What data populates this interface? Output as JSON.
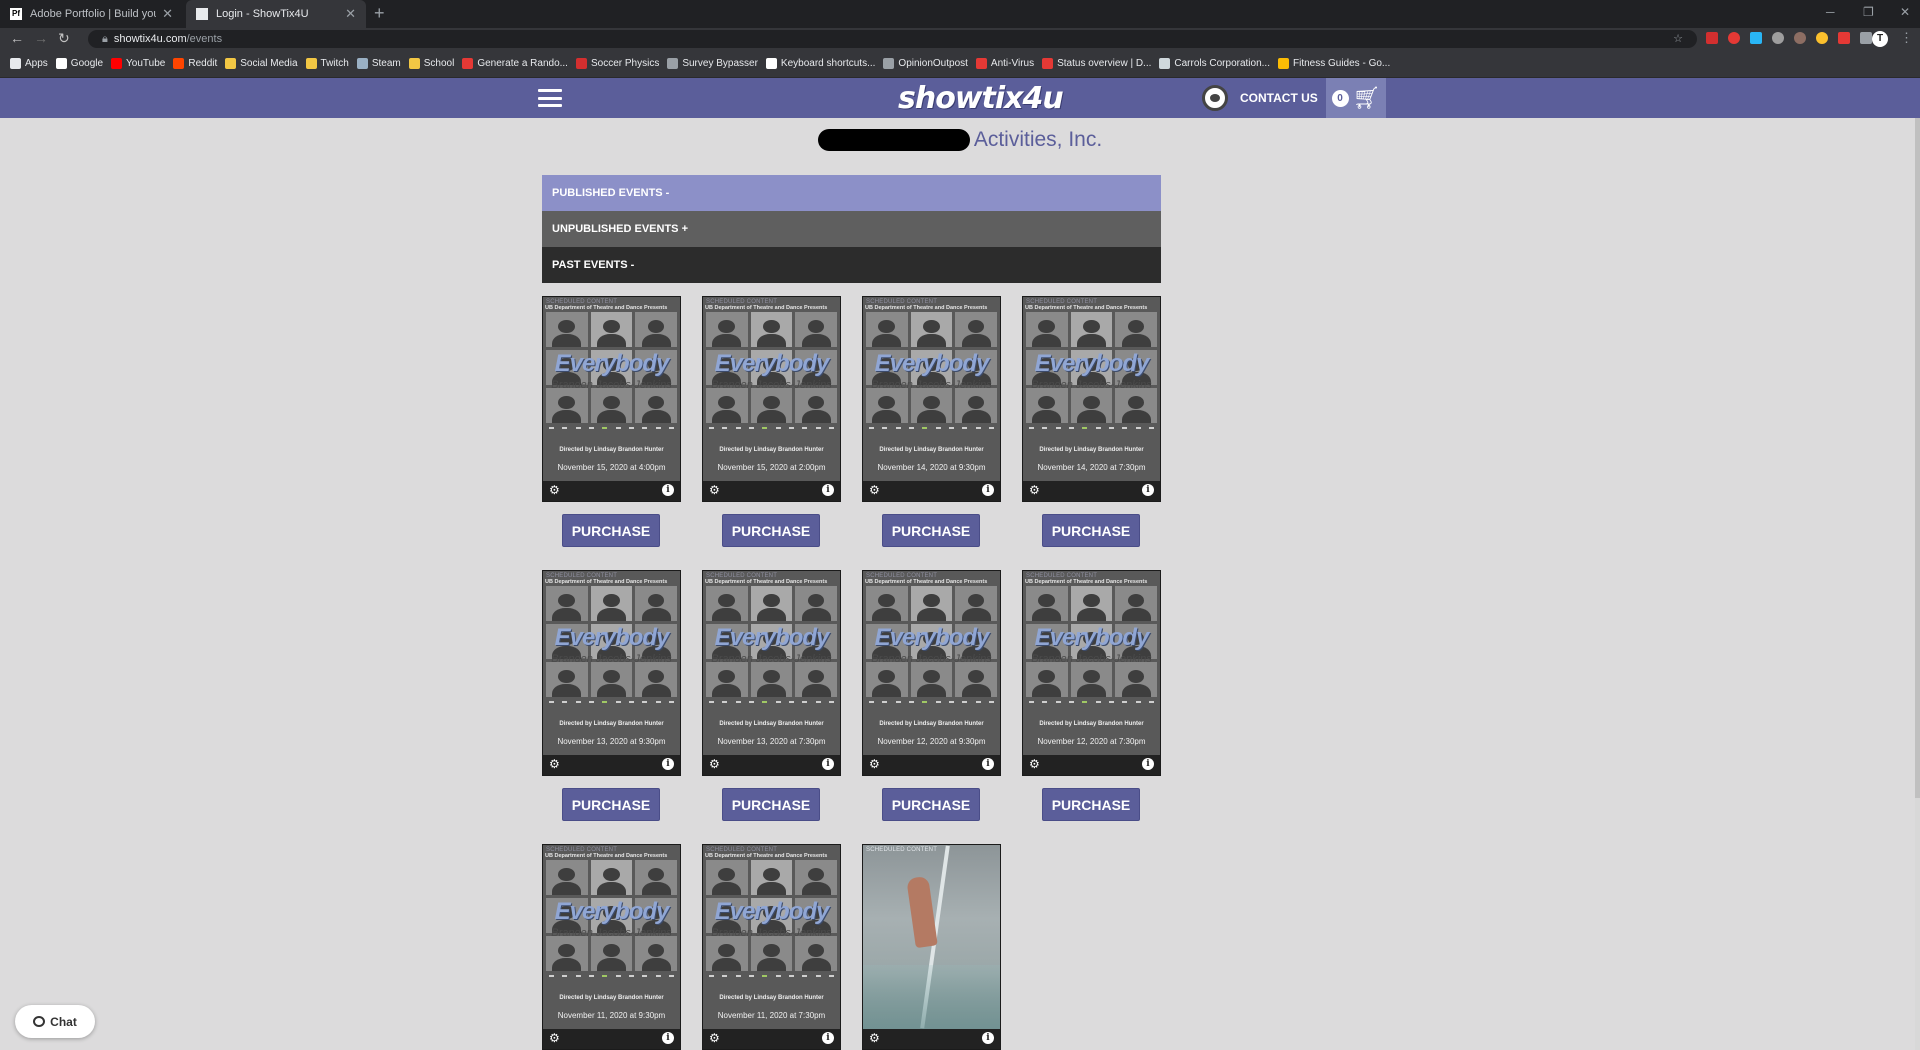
{
  "browser": {
    "tabs": [
      {
        "label": "Adobe Portfolio | Build your own",
        "favicon": "Pf"
      },
      {
        "label": "Login - ShowTix4U"
      }
    ],
    "url_host": "showtix4u.com",
    "url_path": "/events",
    "bookmarks": [
      {
        "label": "Apps",
        "icon": "grid-icon",
        "color": "#e8eaed"
      },
      {
        "label": "Google",
        "icon": "google-icon",
        "color": "#ffffff"
      },
      {
        "label": "YouTube",
        "icon": "youtube-icon",
        "color": "#ff0000"
      },
      {
        "label": "Reddit",
        "icon": "reddit-icon",
        "color": "#ff4500"
      },
      {
        "label": "Social Media",
        "icon": "folder-icon",
        "color": "#f2c744"
      },
      {
        "label": "Twitch",
        "icon": "folder-icon",
        "color": "#f2c744"
      },
      {
        "label": "Steam",
        "icon": "steam-icon",
        "color": "#9ab0c4"
      },
      {
        "label": "School",
        "icon": "folder-icon",
        "color": "#f2c744"
      },
      {
        "label": "Generate a Rando...",
        "icon": "f-icon",
        "color": "#e53935"
      },
      {
        "label": "Soccer Physics",
        "icon": "k-icon",
        "color": "#d32f2f"
      },
      {
        "label": "Survey Bypasser",
        "icon": "globe-icon",
        "color": "#9aa0a6"
      },
      {
        "label": "Keyboard shortcuts...",
        "icon": "google-icon",
        "color": "#ffffff"
      },
      {
        "label": "OpinionOutpost",
        "icon": "globe-icon",
        "color": "#9aa0a6"
      },
      {
        "label": "Anti-Virus",
        "icon": "shield-icon",
        "color": "#e53935"
      },
      {
        "label": "Status overview | D...",
        "icon": "alert-icon",
        "color": "#e53935"
      },
      {
        "label": "Carrols Corporation...",
        "icon": "doc-icon",
        "color": "#cfd8dc"
      },
      {
        "label": "Fitness Guides - Go...",
        "icon": "drive-icon",
        "color": "#fbbc04"
      }
    ]
  },
  "site": {
    "logo": "showtix4u",
    "contact_label": "CONTACT US",
    "cart_count": "0"
  },
  "page": {
    "org_suffix": "Activities, Inc.",
    "sections": [
      {
        "label": "PUBLISHED EVENTS -"
      },
      {
        "label": "UNPUBLISHED EVENTS +"
      },
      {
        "label": "PAST EVENTS -"
      }
    ],
    "purchase_label": "PURCHASE",
    "poster": {
      "scheduled": "SCHEDULED CONTENT",
      "dept": "UB Department of Theatre and Dance Presents",
      "title": "Everybody",
      "author": "Branden Jacobs-Jenkins",
      "director": "Directed by Lindsay Brandon Hunter"
    },
    "events": [
      {
        "date": "November 15, 2020 at 4:00pm"
      },
      {
        "date": "November 15, 2020 at 2:00pm"
      },
      {
        "date": "November 14, 2020 at 9:30pm"
      },
      {
        "date": "November 14, 2020 at 7:30pm"
      },
      {
        "date": "November 13, 2020 at 9:30pm"
      },
      {
        "date": "November 13, 2020 at 7:30pm"
      },
      {
        "date": "November 12, 2020 at 9:30pm"
      },
      {
        "date": "November 12, 2020 at 7:30pm"
      },
      {
        "date": "November 11, 2020 at 9:30pm"
      },
      {
        "date": "November 11, 2020 at 7:30pm"
      },
      {
        "date": ""
      }
    ]
  },
  "chat": {
    "label": "Chat"
  }
}
